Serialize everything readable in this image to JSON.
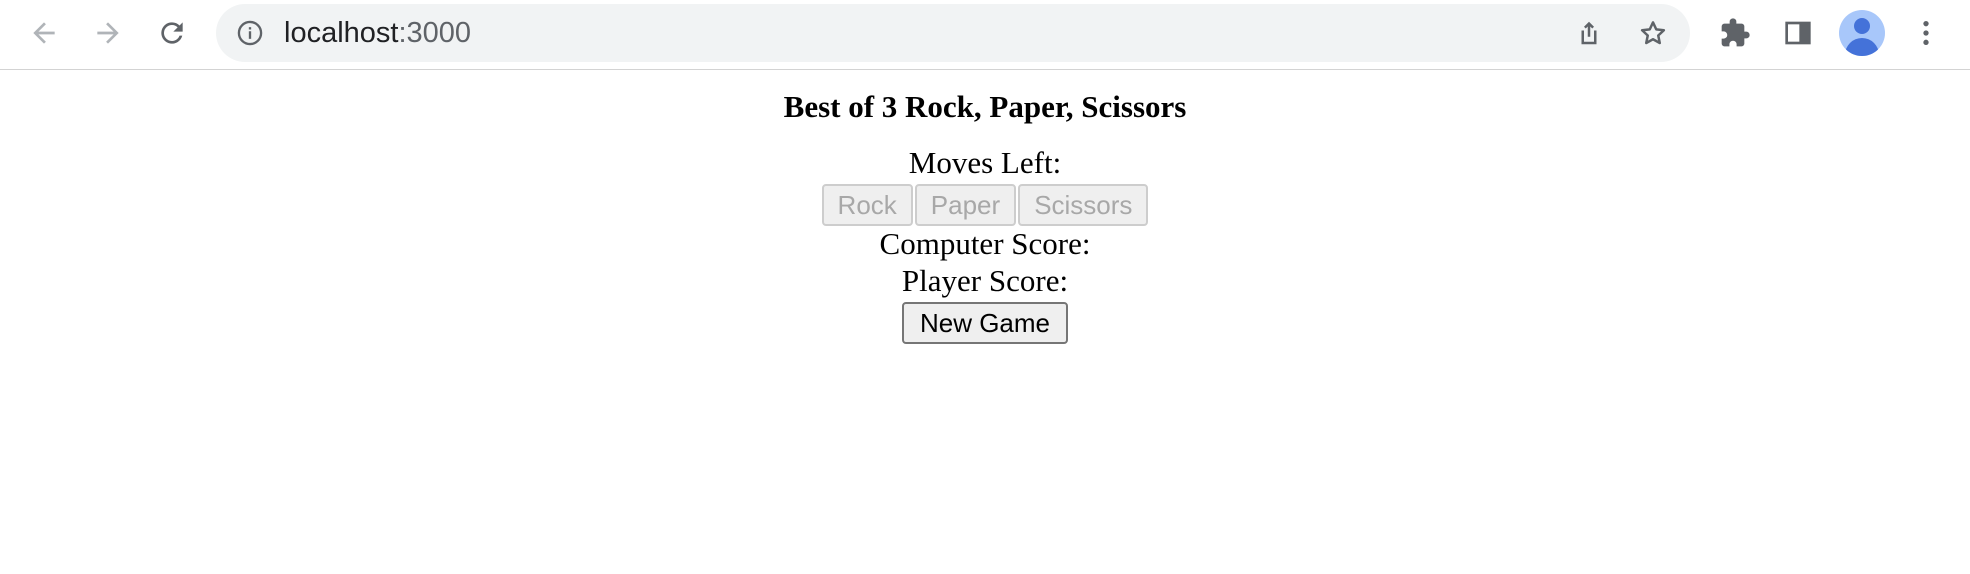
{
  "browser": {
    "url_host": "localhost",
    "url_port": ":3000",
    "icons": {
      "back": "arrow-left-icon",
      "forward": "arrow-right-icon",
      "reload": "reload-icon",
      "site_info": "info-icon",
      "share": "share-icon",
      "bookmark": "star-icon",
      "extensions": "puzzle-icon",
      "side_panel": "side-panel-icon",
      "profile": "avatar-icon",
      "menu": "more-vertical-icon"
    }
  },
  "page": {
    "title": "Best of 3 Rock, Paper, Scissors",
    "moves_left_label": "Moves Left:",
    "moves": {
      "rock": "Rock",
      "paper": "Paper",
      "scissors": "Scissors"
    },
    "moves_disabled": true,
    "computer_score_label": "Computer Score:",
    "player_score_label": "Player Score:",
    "new_game_label": "New Game"
  },
  "colors": {
    "chrome_bg": "#ffffff",
    "omnibox_bg": "#f1f3f4",
    "icon": "#5f6368",
    "disabled_icon": "#9aa0a6",
    "avatar_bg": "#a8c7fa",
    "avatar_fg": "#4472d9",
    "disabled_text": "#a8a8a8"
  }
}
